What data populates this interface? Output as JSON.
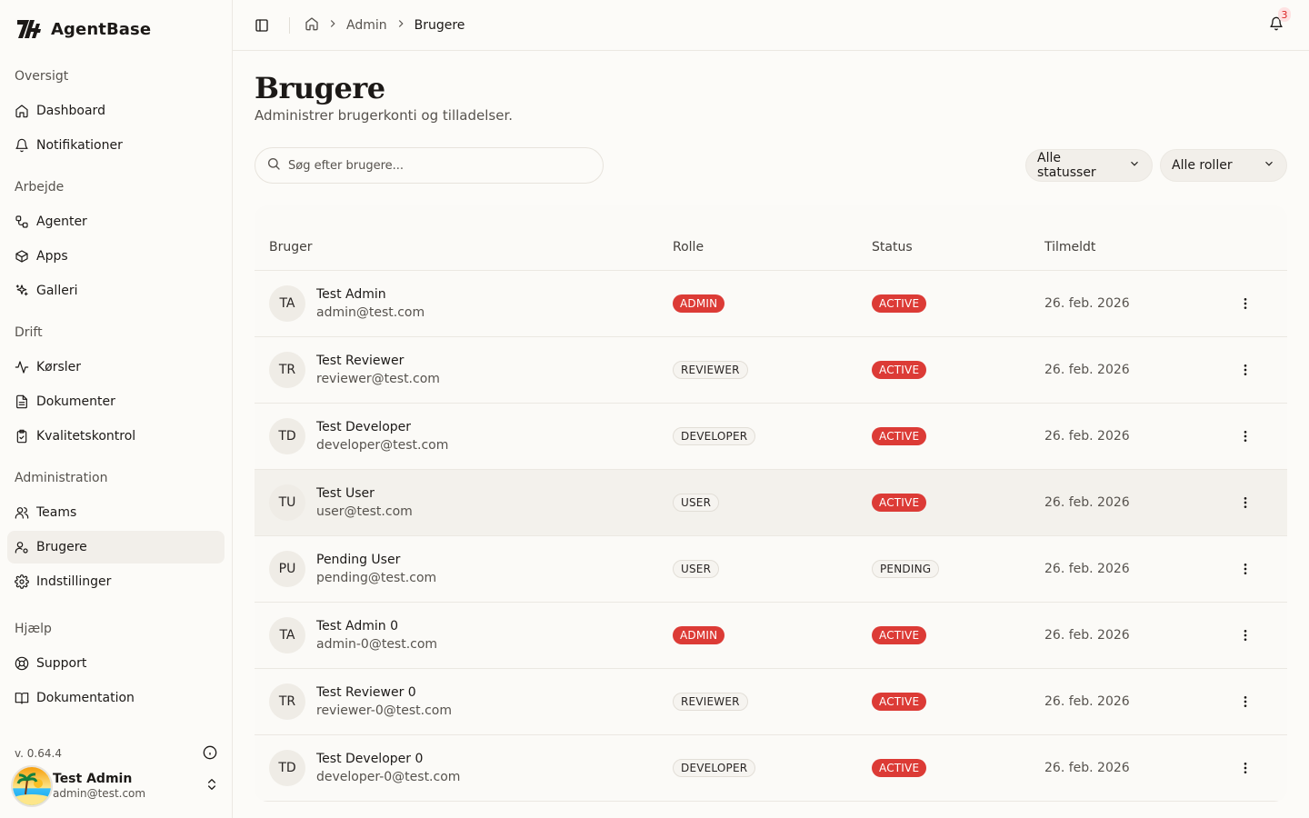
{
  "brand": {
    "name": "AgentBase"
  },
  "sidebar": {
    "groups": [
      {
        "label": "Oversigt",
        "items": [
          {
            "label": "Dashboard",
            "icon": "home-icon"
          },
          {
            "label": "Notifikationer",
            "icon": "bell-icon"
          }
        ]
      },
      {
        "label": "Arbejde",
        "items": [
          {
            "label": "Agenter",
            "icon": "workflow-icon"
          },
          {
            "label": "Apps",
            "icon": "package-icon"
          },
          {
            "label": "Galleri",
            "icon": "sparkles-icon"
          }
        ]
      },
      {
        "label": "Drift",
        "items": [
          {
            "label": "Kørsler",
            "icon": "activity-icon"
          },
          {
            "label": "Dokumenter",
            "icon": "document-icon"
          },
          {
            "label": "Kvalitetskontrol",
            "icon": "clipboard-check-icon"
          }
        ]
      },
      {
        "label": "Administration",
        "items": [
          {
            "label": "Teams",
            "icon": "users-icon"
          },
          {
            "label": "Brugere",
            "icon": "user-cog-icon",
            "active": true
          },
          {
            "label": "Indstillinger",
            "icon": "gear-icon"
          }
        ]
      },
      {
        "label": "Hjælp",
        "items": [
          {
            "label": "Support",
            "icon": "lifebuoy-icon"
          },
          {
            "label": "Dokumentation",
            "icon": "book-icon"
          }
        ]
      }
    ],
    "version": "v. 0.64.4",
    "user": {
      "name": "Test Admin",
      "email": "admin@test.com"
    }
  },
  "topbar": {
    "breadcrumb": [
      "Admin",
      "Brugere"
    ],
    "notification_count": "3"
  },
  "page": {
    "title": "Brugere",
    "subtitle": "Administrer brugerkonti og tilladelser.",
    "search_placeholder": "Søg efter brugere...",
    "status_filter": "Alle statusser",
    "role_filter": "Alle roller"
  },
  "table": {
    "headers": {
      "user": "Bruger",
      "role": "Rolle",
      "status": "Status",
      "joined": "Tilmeldt"
    },
    "rows": [
      {
        "initials": "TA",
        "name": "Test Admin",
        "email": "admin@test.com",
        "role": "ADMIN",
        "role_style": "red",
        "status": "ACTIVE",
        "status_style": "red",
        "joined": "26. feb. 2026"
      },
      {
        "initials": "TR",
        "name": "Test Reviewer",
        "email": "reviewer@test.com",
        "role": "REVIEWER",
        "role_style": "outline",
        "status": "ACTIVE",
        "status_style": "red",
        "joined": "26. feb. 2026"
      },
      {
        "initials": "TD",
        "name": "Test Developer",
        "email": "developer@test.com",
        "role": "DEVELOPER",
        "role_style": "outline",
        "status": "ACTIVE",
        "status_style": "red",
        "joined": "26. feb. 2026"
      },
      {
        "initials": "TU",
        "name": "Test User",
        "email": "user@test.com",
        "role": "USER",
        "role_style": "outline",
        "status": "ACTIVE",
        "status_style": "red",
        "joined": "26. feb. 2026",
        "hover": true
      },
      {
        "initials": "PU",
        "name": "Pending User",
        "email": "pending@test.com",
        "role": "USER",
        "role_style": "outline",
        "status": "PENDING",
        "status_style": "outline",
        "joined": "26. feb. 2026"
      },
      {
        "initials": "TA",
        "name": "Test Admin 0",
        "email": "admin-0@test.com",
        "role": "ADMIN",
        "role_style": "red",
        "status": "ACTIVE",
        "status_style": "red",
        "joined": "26. feb. 2026"
      },
      {
        "initials": "TR",
        "name": "Test Reviewer 0",
        "email": "reviewer-0@test.com",
        "role": "REVIEWER",
        "role_style": "outline",
        "status": "ACTIVE",
        "status_style": "red",
        "joined": "26. feb. 2026"
      },
      {
        "initials": "TD",
        "name": "Test Developer 0",
        "email": "developer-0@test.com",
        "role": "DEVELOPER",
        "role_style": "outline",
        "status": "ACTIVE",
        "status_style": "red",
        "joined": "26. feb. 2026"
      }
    ]
  }
}
